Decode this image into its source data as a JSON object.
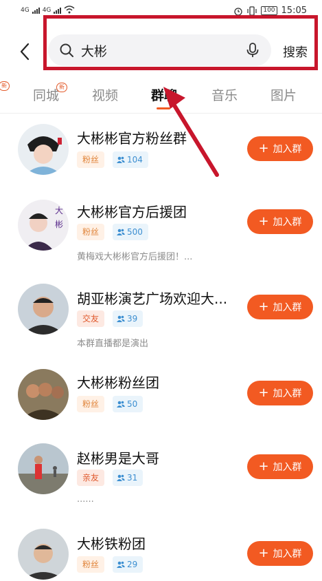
{
  "status_bar": {
    "network_1": "4G",
    "network_2": "4G",
    "battery": "100",
    "time": "15:05"
  },
  "search": {
    "query": "大彬",
    "submit_label": "搜索"
  },
  "tabs": [
    {
      "label": "同城",
      "badge": "新"
    },
    {
      "label": "视频"
    },
    {
      "label": "群聊",
      "active": true
    },
    {
      "label": "音乐"
    },
    {
      "label": "图片"
    }
  ],
  "partial_left_badge": "新",
  "groups": [
    {
      "name": "大彬彬官方粉丝群",
      "tag": "粉丝",
      "members": "104",
      "desc": "",
      "join_label": "加入群"
    },
    {
      "name": "大彬彬官方后援团",
      "tag": "粉丝",
      "members": "500",
      "desc": "黄梅戏大彬彬官方后援团！...",
      "join_label": "加入群"
    },
    {
      "name": "胡亚彬演艺广场欢迎大...",
      "tag": "交友",
      "members": "39",
      "desc": "本群直播都是演出",
      "join_label": "加入群"
    },
    {
      "name": "大彬彬粉丝团",
      "tag": "粉丝",
      "members": "50",
      "desc": "",
      "join_label": "加入群"
    },
    {
      "name": "赵彬男是大哥",
      "tag": "亲友",
      "members": "31",
      "desc": "......",
      "join_label": "加入群"
    },
    {
      "name": "大彬铁粉团",
      "tag": "粉丝",
      "members": "29",
      "desc": "",
      "join_label": "加入群"
    }
  ],
  "colors": {
    "accent": "#f25a22",
    "highlight_box": "#c8162c",
    "annotation_arrow": "#c8162c"
  }
}
